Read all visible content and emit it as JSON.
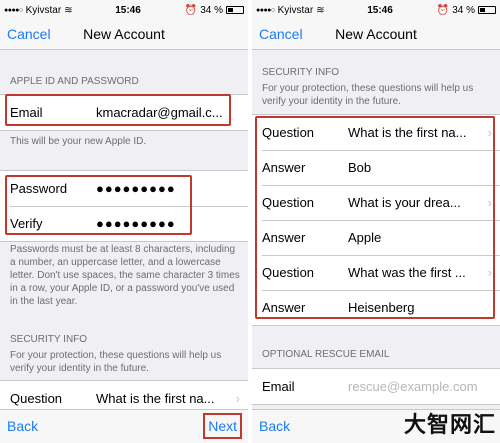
{
  "status": {
    "carrier": "Kyivstar",
    "time": "15:46",
    "battery": "34 %"
  },
  "left": {
    "nav": {
      "cancel": "Cancel",
      "title": "New Account"
    },
    "apple_id_header": "APPLE ID AND PASSWORD",
    "email": {
      "label": "Email",
      "value": "kmacradar@gmail.c..."
    },
    "email_note": "This will be your new Apple ID.",
    "password": {
      "label": "Password",
      "value": "●●●●●●●●●"
    },
    "verify": {
      "label": "Verify",
      "value": "●●●●●●●●●"
    },
    "password_note": "Passwords must be at least 8 characters, including a number, an uppercase letter, and a lowercase letter. Don't use spaces, the same character 3 times in a row, your Apple ID, or a password you've used in the last year.",
    "security_header": "SECURITY INFO",
    "security_note": "For your protection, these questions will help us verify your identity in the future.",
    "question": {
      "label": "Question",
      "value": "What is the first na..."
    },
    "toolbar": {
      "back": "Back",
      "next": "Next"
    }
  },
  "right": {
    "nav": {
      "cancel": "Cancel",
      "title": "New Account"
    },
    "security_header": "SECURITY INFO",
    "security_note": "For your protection, these questions will help us verify your identity in the future.",
    "rows": [
      {
        "label": "Question",
        "value": "What is the first na..."
      },
      {
        "label": "Answer",
        "value": "Bob"
      },
      {
        "label": "Question",
        "value": "What is your drea..."
      },
      {
        "label": "Answer",
        "value": "Apple"
      },
      {
        "label": "Question",
        "value": "What was the first ..."
      },
      {
        "label": "Answer",
        "value": "Heisenberg"
      }
    ],
    "rescue_header": "OPTIONAL RESCUE EMAIL",
    "rescue": {
      "label": "Email",
      "placeholder": "rescue@example.com"
    },
    "toolbar": {
      "back": "Back"
    }
  },
  "watermark": "大智网汇",
  "colors": {
    "accent": "#1a7cf5",
    "highlight": "#c0392b",
    "background": "#efeff4"
  }
}
